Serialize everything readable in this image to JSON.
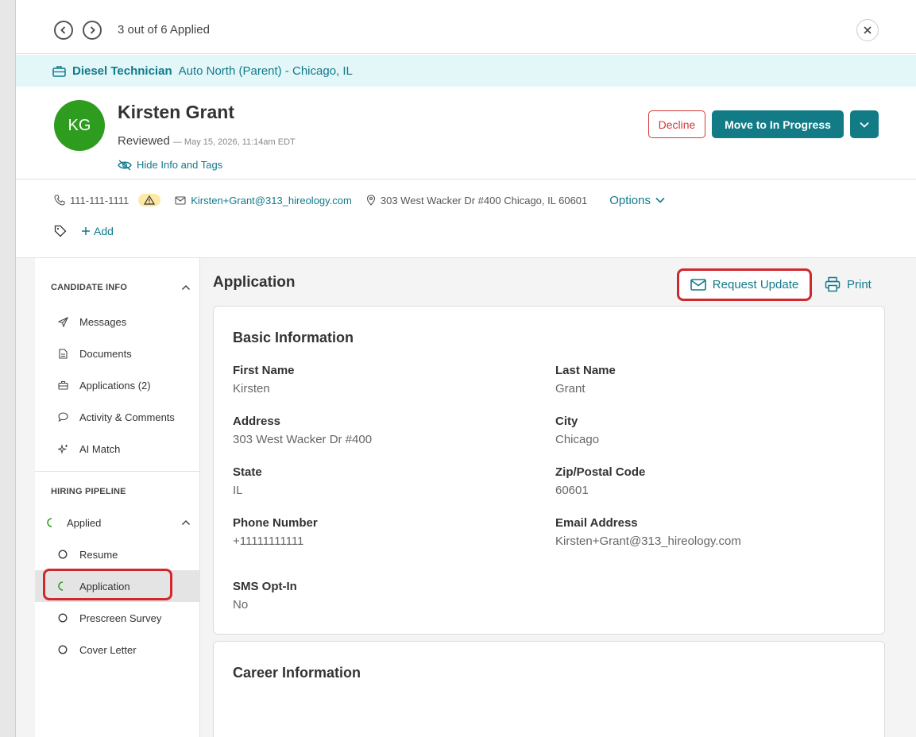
{
  "nav": {
    "counter_text": "3 out of 6 Applied"
  },
  "job": {
    "title": "Diesel Technician",
    "location": "Auto North (Parent) - Chicago, IL"
  },
  "candidate": {
    "initials": "KG",
    "name": "Kirsten Grant",
    "status": "Reviewed",
    "timestamp": "— May 15, 2026, 11:14am EDT",
    "hide_info_label": "Hide Info and Tags",
    "avatar_color": "#2e9c1f"
  },
  "actions": {
    "decline_label": "Decline",
    "move_label": "Move to In Progress"
  },
  "contact": {
    "phone": "111-111-1111",
    "email": "Kirsten+Grant@313_hireology.com",
    "address": "303 West Wacker Dr #400 Chicago, IL 60601",
    "options_label": "Options",
    "add_tag_label": "Add"
  },
  "sidebar": {
    "candidate_info_header": "CANDIDATE INFO",
    "candidate_items": [
      {
        "label": "Messages",
        "icon": "send-icon"
      },
      {
        "label": "Documents",
        "icon": "document-icon"
      },
      {
        "label": "Applications (2)",
        "icon": "briefcase-icon"
      },
      {
        "label": "Activity & Comments",
        "icon": "comment-icon"
      },
      {
        "label": "AI Match",
        "icon": "sparkle-icon"
      }
    ],
    "pipeline_header": "HIRING PIPELINE",
    "pipeline_stage": "Applied",
    "pipeline_items": [
      {
        "label": "Resume",
        "icon": "circle-icon"
      },
      {
        "label": "Application",
        "icon": "progress-icon"
      },
      {
        "label": "Prescreen Survey",
        "icon": "circle-icon"
      },
      {
        "label": "Cover Letter",
        "icon": "circle-icon"
      }
    ]
  },
  "content": {
    "title": "Application",
    "request_update_label": "Request Update",
    "print_label": "Print",
    "basic_info": {
      "title": "Basic Information",
      "fields": [
        {
          "label": "First Name",
          "value": "Kirsten"
        },
        {
          "label": "Last Name",
          "value": "Grant"
        },
        {
          "label": "Address",
          "value": "303 West Wacker Dr #400"
        },
        {
          "label": "City",
          "value": "Chicago"
        },
        {
          "label": "State",
          "value": "IL"
        },
        {
          "label": "Zip/Postal Code",
          "value": "60601"
        },
        {
          "label": "Phone Number",
          "value": "+11111111111"
        },
        {
          "label": "Email Address",
          "value": "Kirsten+Grant@313_hireology.com"
        },
        {
          "label": "SMS Opt-In",
          "value": "No"
        }
      ]
    },
    "career_info": {
      "title": "Career Information"
    }
  },
  "colors": {
    "brand": "#127b86",
    "link": "#117a8b",
    "decline": "#d23a3a",
    "highlight": "#d0282d",
    "banner": "#e3f6f8"
  }
}
